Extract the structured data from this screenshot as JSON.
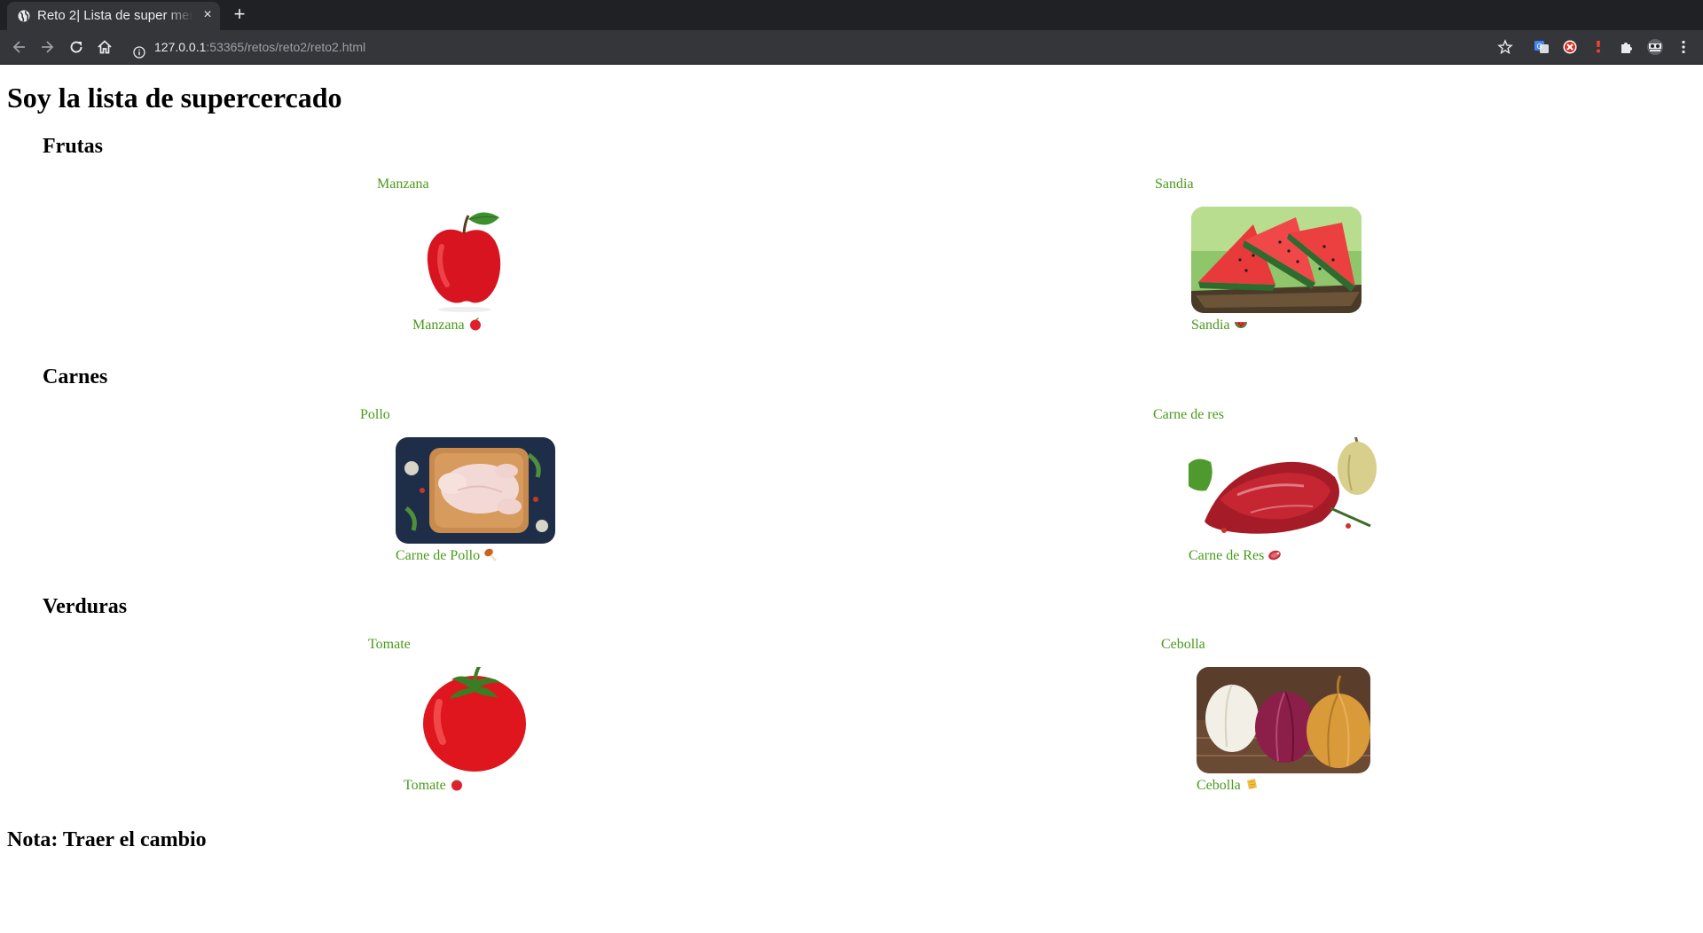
{
  "browser": {
    "tab_title": "Reto 2| Lista de super mercado",
    "tab_close": "×",
    "new_tab": "+",
    "url_host": "127.0.0.1",
    "url_rest": ":53365/retos/reto2/reto2.html"
  },
  "page": {
    "title": "Soy la lista de supercercado",
    "note": "Nota: Traer el cambio"
  },
  "categories": [
    {
      "title": "Frutas",
      "items": [
        {
          "label": "Manzana",
          "caption": "Manzana",
          "emoji": "red-apple-icon"
        },
        {
          "label": "Sandia",
          "caption": "Sandia",
          "emoji": "watermelon-icon"
        }
      ]
    },
    {
      "title": "Carnes",
      "items": [
        {
          "label": "Pollo",
          "caption": "Carne de Pollo",
          "emoji": "poultry-leg-icon"
        },
        {
          "label": "Carne de res",
          "caption": "Carne de Res",
          "emoji": "cut-of-meat-icon"
        }
      ]
    },
    {
      "title": "Verduras",
      "items": [
        {
          "label": "Tomate",
          "caption": "Tomate",
          "emoji": "tomato-icon"
        },
        {
          "label": "Cebolla",
          "caption": "Cebolla",
          "emoji": "onion-icon"
        }
      ]
    }
  ],
  "colors": {
    "link_green": "#4a9a1a",
    "chrome_dark": "#202124",
    "chrome_toolbar": "#35363a"
  }
}
